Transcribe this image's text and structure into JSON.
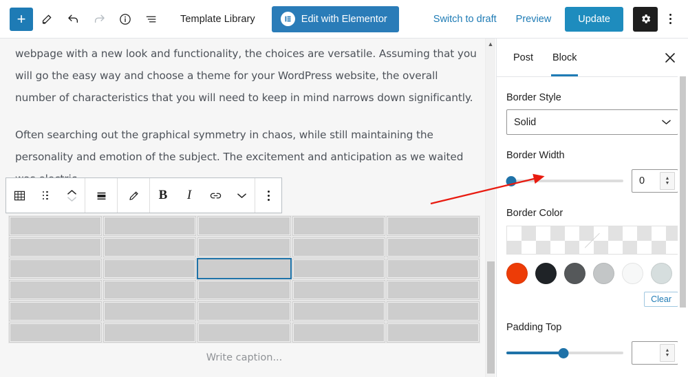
{
  "toolbar": {
    "add_block_label": "+",
    "add_block_name": "add-block",
    "tools_icon": "pencil-icon",
    "undo_icon": "undo-icon",
    "redo_icon": "redo-icon",
    "info_icon": "info-icon",
    "list_view_icon": "list-view-icon",
    "template_library": "Template Library",
    "elementor_button": "Edit with Elementor",
    "elementor_badge": "E",
    "switch_to_draft": "Switch to draft",
    "preview": "Preview",
    "update": "Update",
    "settings_icon": "gear-icon",
    "options_icon": "kebab-menu-icon"
  },
  "editor": {
    "paragraph_1": "webpage with a new look and functionality, the choices are versatile. Assuming that you will go the easy way and choose a theme for your WordPress website, the overall number of characteristics that you will need to keep in mind narrows down significantly.",
    "paragraph_2": "Often searching out the graphical symmetry in chaos, while still maintaining the personality and emotion of the subject. The excitement and anticipation as we waited was electric.",
    "caption_placeholder": "Write caption...",
    "block_toolbar": {
      "block_type_icon": "table-icon",
      "drag_handle_icon": "drag-handle-icon",
      "move_up_icon": "chevron-up-icon",
      "move_down_icon": "chevron-down-icon",
      "align_icon": "align-center-icon",
      "edit_icon": "pencil-edit-icon",
      "bold_label": "B",
      "italic_label": "I",
      "link_icon": "link-icon",
      "more_formats_icon": "chevron-down-icon",
      "options_icon": "kebab-menu-icon"
    },
    "table": {
      "rows": 6,
      "columns": 5,
      "selected_cell": {
        "row": 3,
        "column": 3
      },
      "cells": [
        [
          "",
          "",
          "",
          "",
          ""
        ],
        [
          "",
          "",
          "",
          "",
          ""
        ],
        [
          "",
          "",
          "",
          "",
          ""
        ],
        [
          "",
          "",
          "",
          "",
          ""
        ],
        [
          "",
          "",
          "",
          "",
          ""
        ],
        [
          "",
          "",
          "",
          "",
          ""
        ]
      ]
    }
  },
  "sidebar": {
    "tabs": [
      {
        "label": "Post",
        "active": false
      },
      {
        "label": "Block",
        "active": true
      }
    ],
    "close_icon": "close-icon",
    "border_style": {
      "label": "Border Style",
      "value": "Solid",
      "chevron_icon": "chevron-down-icon"
    },
    "border_width": {
      "label": "Border Width",
      "value": "0",
      "slider_percent": 0
    },
    "border_color": {
      "label": "Border Color",
      "swatch_value": "transparent",
      "palette": [
        "#ED3C07",
        "#1F2327",
        "#55585A",
        "#C3C6C7",
        "#F7F8F8",
        "#D6DEDE"
      ],
      "clear_label": "Clear"
    },
    "padding_top": {
      "label": "Padding Top",
      "value": "",
      "slider_percent": 48
    }
  },
  "colors": {
    "accent_blue": "#1e7bb5",
    "update_blue": "#1e8cbe",
    "elementor_blue": "#2a7cb8",
    "annotation_red": "#e81b10",
    "selected_cell_border": "#1e72a8"
  }
}
